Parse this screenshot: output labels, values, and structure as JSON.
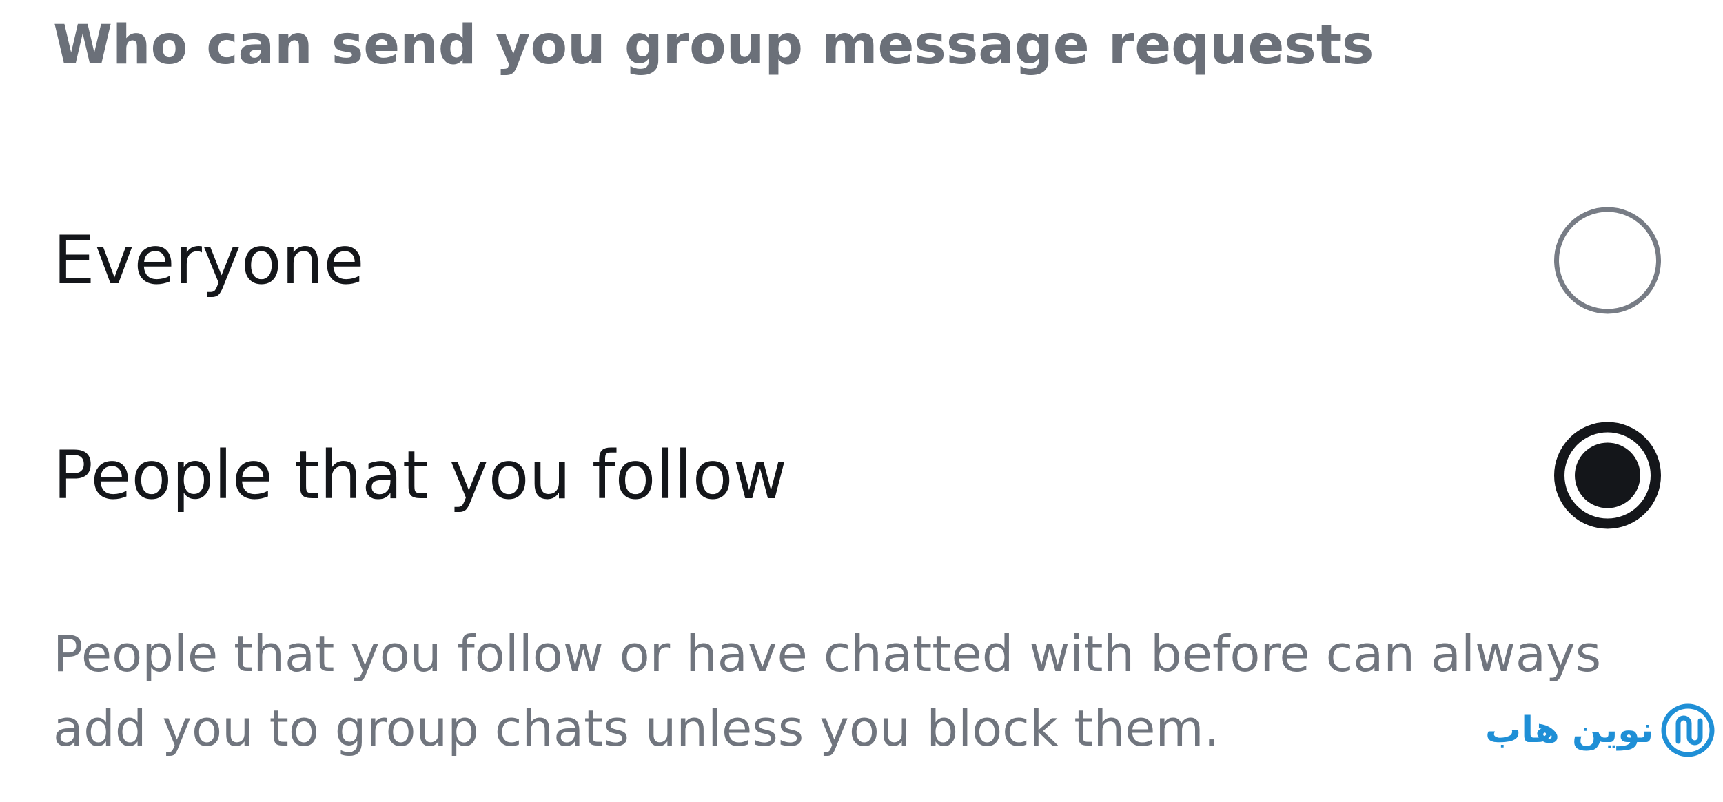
{
  "section": {
    "title": "Who can send you group message requests"
  },
  "options": [
    {
      "label": "Everyone",
      "selected": false
    },
    {
      "label": "People that you follow",
      "selected": true
    }
  ],
  "description": "People that you follow or have chatted with before can always add you to group chats unless you block them.",
  "watermark": {
    "text": "نوین هاب",
    "icon": "novinhub-logo-icon",
    "color": "#1f8fd6"
  },
  "colors": {
    "title": "#6b7079",
    "label": "#14161a",
    "description": "#70757e",
    "radio_unchecked": "#777c85",
    "radio_checked": "#14161a"
  }
}
